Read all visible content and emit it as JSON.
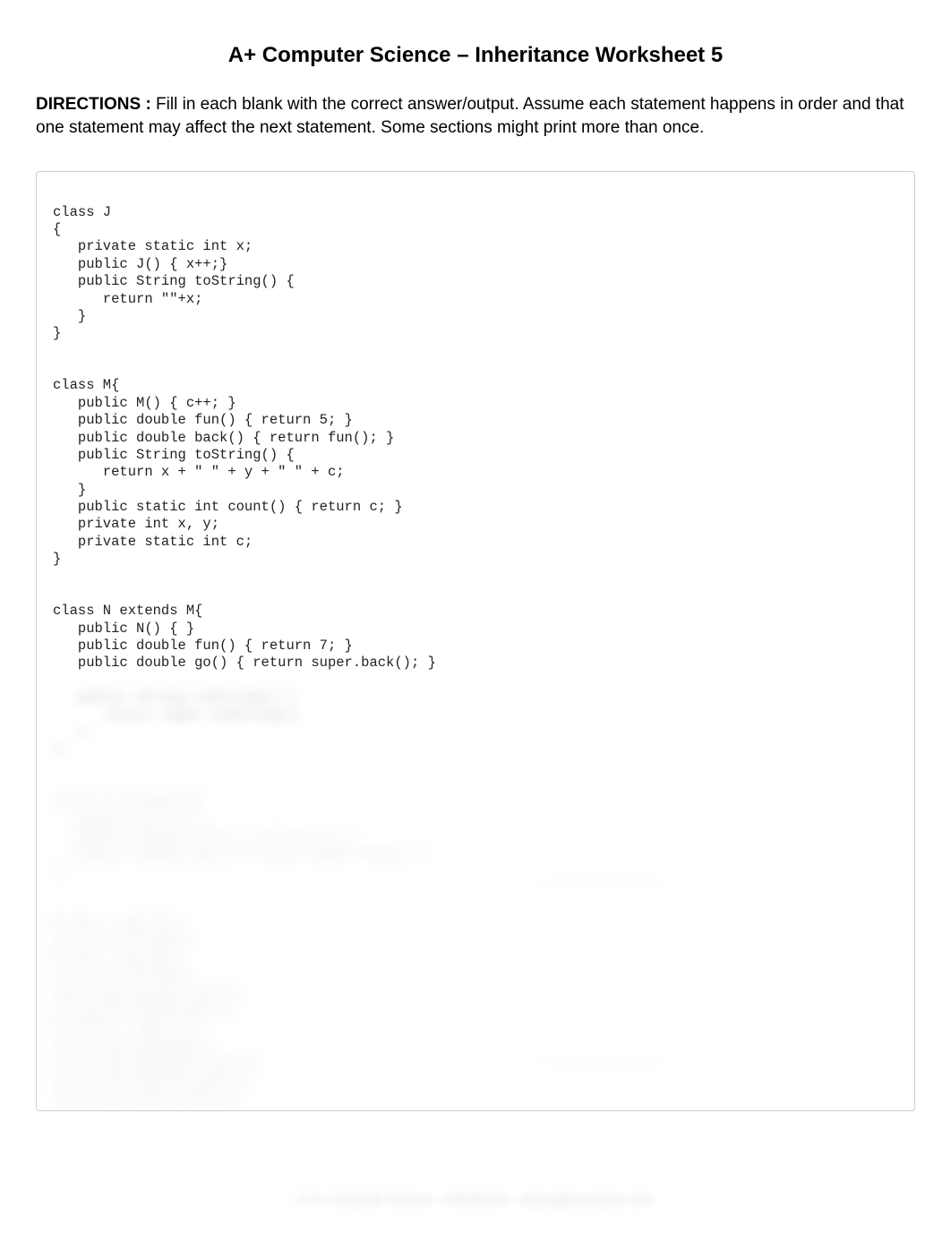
{
  "title": "A+ Computer Science –  Inheritance Worksheet 5",
  "directions": {
    "label": "DIRECTIONS :",
    "text": "  Fill in each blank with the correct answer/output.  Assume each statement happens in order and that one statement may affect the next statement.  Some sections might print more than once."
  },
  "code": {
    "classJ": "class J\n{\n   private static int x;\n   public J() { x++;}\n   public String toString() {\n      return \"\"+x;\n   }\n}",
    "classM": "class M{\n   public M() { c++; }\n   public double fun() { return 5; }\n   public double back() { return fun(); }\n   public String toString() {\n      return x + \" \" + y + \" \" + c;\n   }\n   public static int count() { return c; }\n   private int x, y;\n   private static int c;\n}",
    "classN": "class N extends M{\n   public N() { }\n   public double fun() { return 7; }\n   public double go() { return super.back(); }",
    "blurred1": "   public String toString() {\n      return super.toString();\n   }\n}",
    "blurred2": "class O extends M{\n   public O() { }\n   public double fun() { return 9; }\n   public double go() { return super.fun(); }\n}",
    "blurred3": "M one = new M();\nout.println(one);\nN two = new N();\nout.println(two);\nout.println(two.fun());\nout.println(two.go());\nO three = new O();\nout.println(three);\nout.println(three.fun());\nout.println(three.go());\nout.println(M.count());"
  },
  "footer": "© A+ Computer Science – Worksheet – www.apluscompsci.com",
  "answers": {
    "label1": "// OUTPUT",
    "label2": "// OUTPUT"
  }
}
